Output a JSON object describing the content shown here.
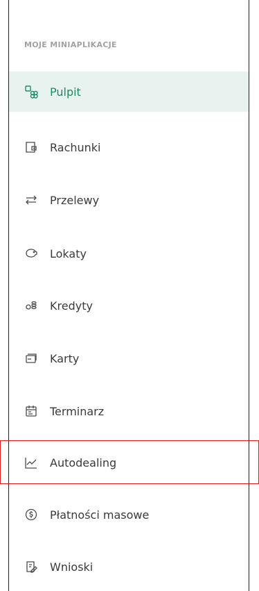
{
  "section": {
    "title": "MOJE MINIAPLIKACJE"
  },
  "items": [
    {
      "label": "Pulpit",
      "icon": "dashboard-icon"
    },
    {
      "label": "Rachunki",
      "icon": "accounts-icon"
    },
    {
      "label": "Przelewy",
      "icon": "transfer-arrows-icon"
    },
    {
      "label": "Lokaty",
      "icon": "piggy-bank-icon"
    },
    {
      "label": "Kredyty",
      "icon": "coins-icon"
    },
    {
      "label": "Karty",
      "icon": "cards-icon"
    },
    {
      "label": "Terminarz",
      "icon": "calendar-icon"
    },
    {
      "label": "Autodealing",
      "icon": "chart-line-icon"
    },
    {
      "label": "Płatności masowe",
      "icon": "dollar-circle-icon"
    },
    {
      "label": "Wnioski",
      "icon": "form-edit-icon"
    }
  ],
  "colors": {
    "accent": "#1f8a62",
    "active_bg": "#e8f3ef",
    "highlight": "#e01b1b"
  }
}
